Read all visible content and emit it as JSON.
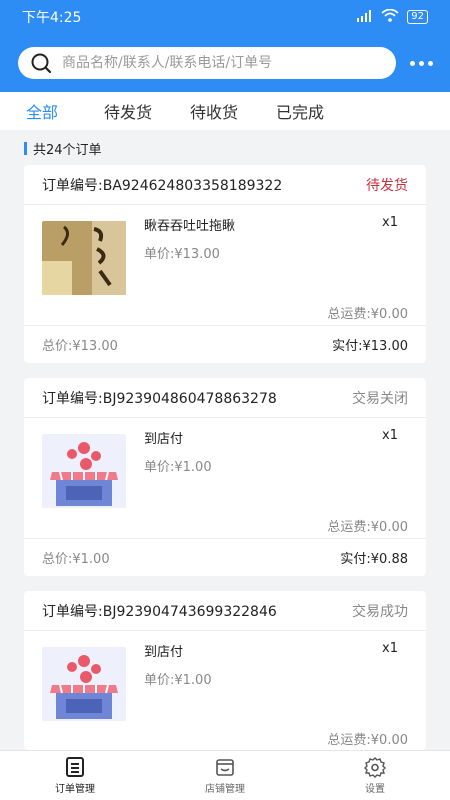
{
  "status_bar": {
    "time": "下午4:25",
    "signal_text": "...",
    "battery": "92"
  },
  "search": {
    "placeholder": "商品名称/联系人/联系电话/订单号"
  },
  "tabs": [
    {
      "label": "全部",
      "active": true
    },
    {
      "label": "待发货"
    },
    {
      "label": "待收货"
    },
    {
      "label": "已完成"
    }
  ],
  "order_count": "共24个订单",
  "orders": [
    {
      "no_label": "订单编号:BA924624803358189322",
      "status": "待发货",
      "status_color": "#c8323c",
      "item": {
        "name": "瞅吞吞吐吐拖瞅",
        "qty": "x1",
        "price": "单价:¥13.00",
        "image": "product-photo"
      },
      "freight": "总运费:¥0.00",
      "total": "总价:¥13.00",
      "paid": "实付:¥13.00"
    },
    {
      "no_label": "订单编号:BJ923904860478863278",
      "status": "交易关闭",
      "status_color": "#888888",
      "item": {
        "name": "到店付",
        "qty": "x1",
        "price": "单价:¥1.00",
        "image": "store-icon"
      },
      "freight": "总运费:¥0.00",
      "total": "总价:¥1.00",
      "paid": "实付:¥0.88"
    },
    {
      "no_label": "订单编号:BJ923904743699322846",
      "status": "交易成功",
      "status_color": "#888888",
      "item": {
        "name": "到店付",
        "qty": "x1",
        "price": "单价:¥1.00",
        "image": "store-icon"
      },
      "freight": "总运费:¥0.00"
    }
  ],
  "bottom_nav": [
    {
      "label": "订单管理",
      "icon": "order-list-icon",
      "active": true
    },
    {
      "label": "店铺管理",
      "icon": "store-manage-icon"
    },
    {
      "label": "设置",
      "icon": "gear-icon"
    }
  ],
  "colors": {
    "brand": "#2e8df5",
    "pending": "#c8323c"
  }
}
